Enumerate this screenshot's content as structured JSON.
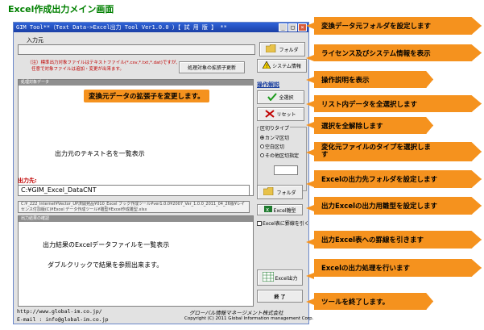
{
  "page_title": "Excel作成出力メイン画面",
  "window": {
    "title": "GIM Tool**（Text Data->Excel出力 Tool Ver1.0.0 ）【 試 用 版 】 **",
    "controls": [
      "_",
      "□",
      "×"
    ]
  },
  "source_folder": {
    "label": "入力元",
    "value": "",
    "button": "フォルダ"
  },
  "notes": [
    "（注）標準出力対象ファイルはテキストファイル(*.csv,*.txt,*.dat)ですが、",
    "任意で対象ファイルは追加・変更が出来ます。"
  ],
  "ext_button": "処理対象の拡張子更新",
  "sysinfo_button": "システム情報",
  "manual_link": "操作解説",
  "list_header": "処理対象データ",
  "list_placeholder": "出力元のテキスト名を一覧表示",
  "select_all_button": "全選択",
  "reset_button": "リセット",
  "delimiter": {
    "title": "区切りタイプ",
    "options": [
      "カンマ区切",
      "空白区切",
      "その他区切指定"
    ],
    "selected": "カンマ区切",
    "custom_value": ""
  },
  "output": {
    "label": "出力先:",
    "value": "C:¥GIM_Excel_DataCNT",
    "button": "フォルダ"
  },
  "template_path": "C:¥_222_Internet¥Vector_UP済開発品¥010_Excel ブック作成ツール¥ver1.0.0¥2007_Ver_1.0.0_2011_04_26版¥レイセンス付加版(C)¥Excel データ作成ツール¥雛型¥Excel作成雛型.xlsx",
  "template_button": "Excel雛型",
  "gridline_checkbox": {
    "label": "Excel表に罫線を引く",
    "checked": false
  },
  "result_header": "出力結果の確認",
  "result_placeholder": [
    "出力結果のExcelデータファイルを一覧表示",
    "ダブルクリックで結果を参照出来ます。"
  ],
  "excel_output_button": "Excel出力",
  "exit_button": "終 了",
  "footer": {
    "url": "http://www.global-im.co.jp/",
    "email": "E-mail : info@global-im.co.jp",
    "company": "グローバル情報マネージメント株式会社",
    "copyright": "Copyright (C) 2011 Global Information management Corp."
  },
  "callouts": {
    "source_folder": "変換データ元フォルダを設定します",
    "license": "ライセンス及びシステム情報を表示",
    "manual": "操作説明を表示",
    "select_all": "リスト内データを全選択します",
    "reset": "選択を全解除します",
    "file_type": "変化元ファイルのタイプを選択しま\nす",
    "output_folder": "Excelの出力先フォルダを設定します",
    "template": "出力Excelの出力用雛型を設定します",
    "gridlines": "出力Excel表への罫線を引きます",
    "excel_output": "Excelの出力処理を行います",
    "exit": "ツールを終了します。",
    "extension": "変換元データの拡張子を変更します。"
  },
  "colors": {
    "callout": "#f5921e",
    "titlebar": "#2f63d9",
    "page_title": "#008000",
    "note": "#c00000"
  }
}
